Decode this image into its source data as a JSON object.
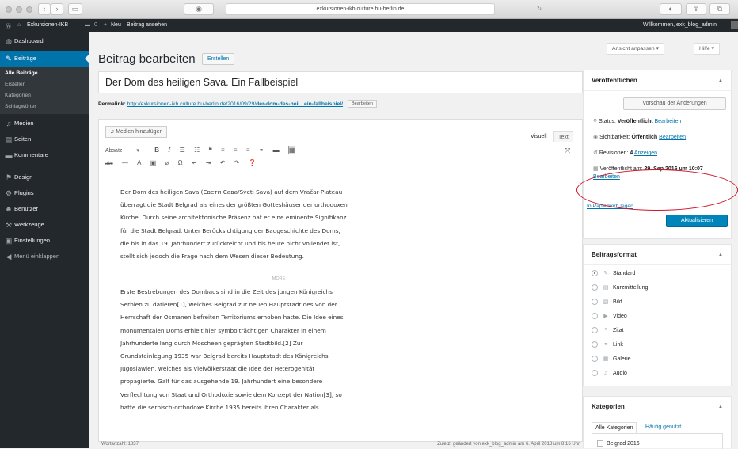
{
  "browser": {
    "url": "exkursionen-ikb.culture.hu-berlin.de",
    "back_icon": "‹",
    "forward_icon": "›"
  },
  "adminbar": {
    "site": "Exkursionen-IKB",
    "comments_count": "0",
    "new_label": "Neu",
    "view_post": "Beitrag ansehen",
    "greeting": "Willkommen, exk_blog_admin"
  },
  "sidebar": {
    "items": [
      {
        "label": "Dashboard",
        "icon": "dashboard-icon",
        "glyph": "◍"
      },
      {
        "label": "Beiträge",
        "icon": "pin-icon",
        "glyph": "✎"
      },
      {
        "label": "Medien",
        "icon": "media-icon",
        "glyph": "♫"
      },
      {
        "label": "Seiten",
        "icon": "pages-icon",
        "glyph": "▤"
      },
      {
        "label": "Kommentare",
        "icon": "comments-icon",
        "glyph": "▬"
      },
      {
        "label": "Design",
        "icon": "brush-icon",
        "glyph": "⚑"
      },
      {
        "label": "Plugins",
        "icon": "plug-icon",
        "glyph": "⚙"
      },
      {
        "label": "Benutzer",
        "icon": "user-icon",
        "glyph": "☻"
      },
      {
        "label": "Werkzeuge",
        "icon": "wrench-icon",
        "glyph": "⚒"
      },
      {
        "label": "Einstellungen",
        "icon": "settings-icon",
        "glyph": "▣"
      },
      {
        "label": "Menü einklappen",
        "icon": "collapse-icon",
        "glyph": "◀"
      }
    ],
    "sub_items": [
      "Alle Beiträge",
      "Erstellen",
      "Kategorien",
      "Schlagwörter"
    ]
  },
  "header": {
    "title": "Beitrag bearbeiten",
    "add_new": "Erstellen",
    "screen_options": "Ansicht anpassen ▾",
    "help": "Hilfe ▾"
  },
  "post": {
    "title": "Der Dom des heiligen Sava. Ein Fallbeispiel",
    "permalink_label": "Permalink:",
    "permalink_base": "http://exkursionen-ikb.culture.hu-berlin.de/2016/09/29/",
    "permalink_slug": "der-dom-des-heil...ein-fallbeispiel/",
    "permalink_edit": "Bearbeiten"
  },
  "editor": {
    "media_button": "Medien hinzufügen",
    "tab_visual": "Visuell",
    "tab_text": "Text",
    "format_select": "Absatz",
    "more_label": "MORE",
    "para1": [
      "Der Dom des heiligen Sava (Свети Сава/Sveti Sava) auf dem Vračar-Plateau",
      "überragt die Stadt Belgrad als eines der größten Gotteshäuser der orthodoxen",
      "Kirche. Durch seine architektonische Präsenz hat er eine eminente Signifikanz",
      "für die Stadt Belgrad. Unter Berücksichtigung der Baugeschichte des Doms,",
      "die bis in das 19. Jahrhundert zurückreicht und bis heute nicht vollendet ist,",
      "stellt sich jedoch die Frage nach dem Wesen dieser Bedeutung."
    ],
    "para2": [
      "Erste Bestrebungen des Dombaus sind in die Zeit des jungen Königreichs",
      "Serbien zu datieren[1], welches Belgrad zur neuen Hauptstadt des von der",
      "Herrschaft der Osmanen befreiten Territoriums erhoben hatte. Die Idee eines",
      "monumentalen Doms erhielt hier symbolträchtigen Charakter in einem",
      "Jahrhunderte lang durch Moscheen geprägten Stadtbild.[2] Zur",
      "Grundsteinlegung 1935 war Belgrad bereits Hauptstadt des Königreichs",
      "Jugoslawien, welches als Vielvölkerstaat die Idee der Heterogenität",
      "propagierte. Galt für das ausgehende 19. Jahrhundert eine besondere",
      "Verflechtung von Staat und Orthodoxie sowie dem Konzept der Nation[3], so",
      "hatte die serbisch-orthodoxe Kirche 1935 bereits ihren Charakter als"
    ],
    "word_count": "Wortanzahl: 1837",
    "last_edited": "Zuletzt geändert von exk_blog_admin am 6. April 2018 um 8:16 Uhr"
  },
  "publish": {
    "title": "Veröffentlichen",
    "preview": "Vorschau der Änderungen",
    "status_label": "Status:",
    "status_value": "Veröffentlicht",
    "visibility_label": "Sichtbarkeit:",
    "visibility_value": "Öffentlich",
    "revisions_label": "Revisionen:",
    "revisions_value": "4",
    "revisions_link": "Anzeigen",
    "published_label": "Veröffentlicht am:",
    "published_value": "29. Sep 2016 um 10:07",
    "edit": "Bearbeiten",
    "trash": "In Papierkorb legen",
    "update": "Aktualisieren"
  },
  "format": {
    "title": "Beitragsformat",
    "options": [
      {
        "label": "Standard",
        "icon": "pin-icon",
        "glyph": "✎",
        "selected": true
      },
      {
        "label": "Kurzmitteilung",
        "icon": "aside-icon",
        "glyph": "▤",
        "selected": false
      },
      {
        "label": "Bild",
        "icon": "image-icon",
        "glyph": "▧",
        "selected": false
      },
      {
        "label": "Video",
        "icon": "video-icon",
        "glyph": "▶",
        "selected": false
      },
      {
        "label": "Zitat",
        "icon": "quote-icon",
        "glyph": "❝",
        "selected": false
      },
      {
        "label": "Link",
        "icon": "link-icon",
        "glyph": "⚭",
        "selected": false
      },
      {
        "label": "Galerie",
        "icon": "gallery-icon",
        "glyph": "▦",
        "selected": false
      },
      {
        "label": "Audio",
        "icon": "audio-icon",
        "glyph": "♫",
        "selected": false
      }
    ]
  },
  "categories": {
    "title": "Kategorien",
    "tab_all": "Alle Kategorien",
    "tab_popular": "Häufig genutzt",
    "first": "Belgrad 2016"
  },
  "colors": {
    "admin_dark": "#23282d",
    "accent": "#0073aa",
    "primary_button": "#0085ba",
    "highlight": "#d0142b"
  }
}
